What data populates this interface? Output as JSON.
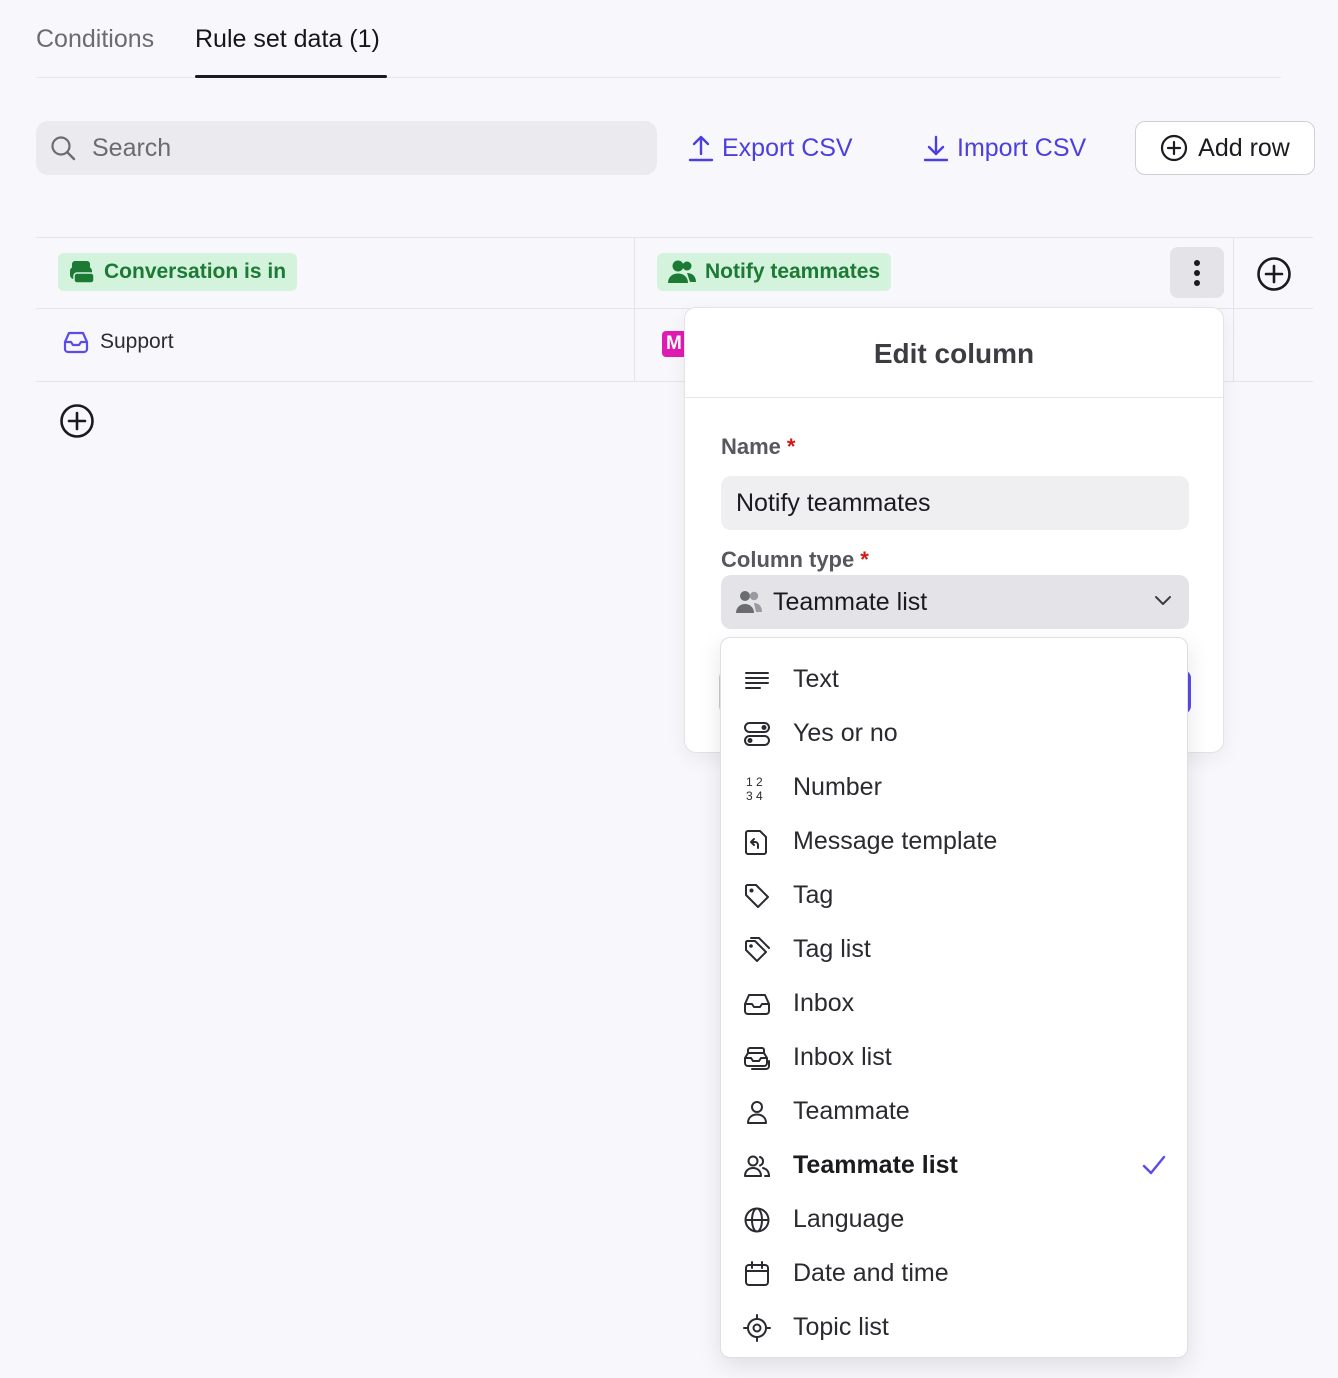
{
  "tabs": [
    {
      "label": "Conditions",
      "active": false
    },
    {
      "label": "Rule set data (1)",
      "active": true
    }
  ],
  "toolbar": {
    "search_placeholder": "Search",
    "export_label": "Export CSV",
    "import_label": "Import CSV",
    "add_row_label": "Add row"
  },
  "table": {
    "columns": [
      {
        "label": "Conversation is in",
        "icon": "inbox-list-icon"
      },
      {
        "label": "Notify teammates",
        "icon": "teammate-list-icon"
      }
    ],
    "rows": [
      {
        "conversation_is_in": "Support",
        "notify_teammates_avatar": "M"
      }
    ]
  },
  "edit_panel": {
    "title": "Edit column",
    "name_label": "Name",
    "name_required": "*",
    "name_value": "Notify teammates",
    "type_label": "Column type",
    "type_required": "*",
    "type_value": "Teammate list"
  },
  "type_menu": {
    "options": [
      {
        "label": "Text",
        "icon": "text-lines-icon"
      },
      {
        "label": "Yes or no",
        "icon": "toggle-icon"
      },
      {
        "label": "Number",
        "icon": "numbers-icon"
      },
      {
        "label": "Message template",
        "icon": "message-template-icon"
      },
      {
        "label": "Tag",
        "icon": "tag-icon"
      },
      {
        "label": "Tag list",
        "icon": "tag-list-icon"
      },
      {
        "label": "Inbox",
        "icon": "inbox-icon"
      },
      {
        "label": "Inbox list",
        "icon": "inbox-list-icon"
      },
      {
        "label": "Teammate",
        "icon": "person-icon"
      },
      {
        "label": "Teammate list",
        "icon": "people-icon",
        "selected": true
      },
      {
        "label": "Language",
        "icon": "globe-icon"
      },
      {
        "label": "Date and time",
        "icon": "calendar-icon"
      },
      {
        "label": "Topic list",
        "icon": "target-icon"
      }
    ]
  },
  "colors": {
    "accent": "#4b3fe0",
    "chip_bg": "#d4f3dc",
    "chip_text": "#1c7a34",
    "avatar_bg": "#e01bb4",
    "required": "#d31717"
  }
}
